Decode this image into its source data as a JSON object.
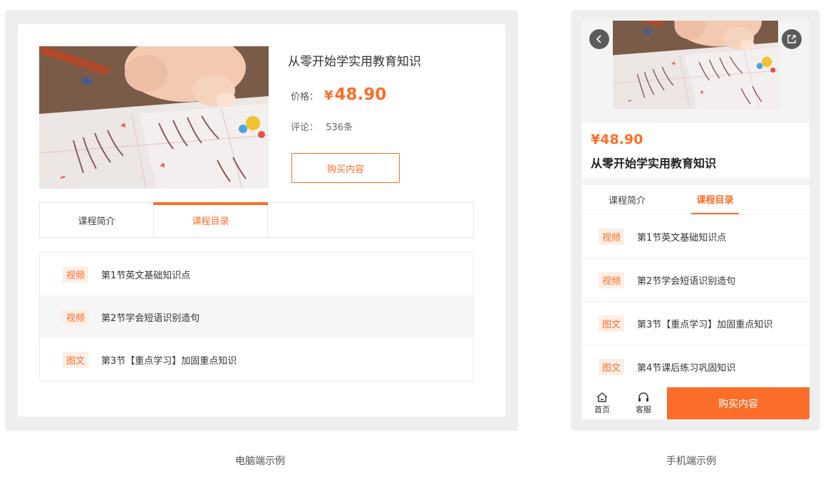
{
  "course": {
    "title": "从零开始学实用教育知识",
    "price_label": "价格：",
    "price_symbol": "¥",
    "price_value": "48.90",
    "price_full": "¥48.90",
    "comment_label": "评论：",
    "comment_count": "536条",
    "buy_label": "购买内容"
  },
  "pc": {
    "tabs": [
      {
        "label": "课程简介",
        "active": false
      },
      {
        "label": "课程目录",
        "active": true
      }
    ],
    "lessons": [
      {
        "tag": "视频",
        "title": "第1节英文基础知识点"
      },
      {
        "tag": "视频",
        "title": "第2节学会短语识别造句"
      },
      {
        "tag": "图文",
        "title": "第3节【重点学习】加固重点知识"
      }
    ],
    "caption": "电脑端示例"
  },
  "mobile": {
    "tabs": [
      {
        "label": "课程简介",
        "active": false
      },
      {
        "label": "课程目录",
        "active": true
      }
    ],
    "lessons": [
      {
        "tag": "视频",
        "title": "第1节英文基础知识点"
      },
      {
        "tag": "视频",
        "title": "第2节学会短语识别造句"
      },
      {
        "tag": "图文",
        "title": "第3节【重点学习】加固重点知识"
      },
      {
        "tag": "图文",
        "title": "第4节课后练习巩固知识"
      }
    ],
    "nav": [
      {
        "label": "首页",
        "icon": "home-icon"
      },
      {
        "label": "客服",
        "icon": "headset-icon"
      }
    ],
    "back_icon": "back-icon",
    "share_icon": "share-icon",
    "caption": "手机端示例"
  },
  "colors": {
    "accent": "#fb6e2a",
    "tag_bg": "#fdeee6",
    "frame_bg": "#eeeeee"
  }
}
